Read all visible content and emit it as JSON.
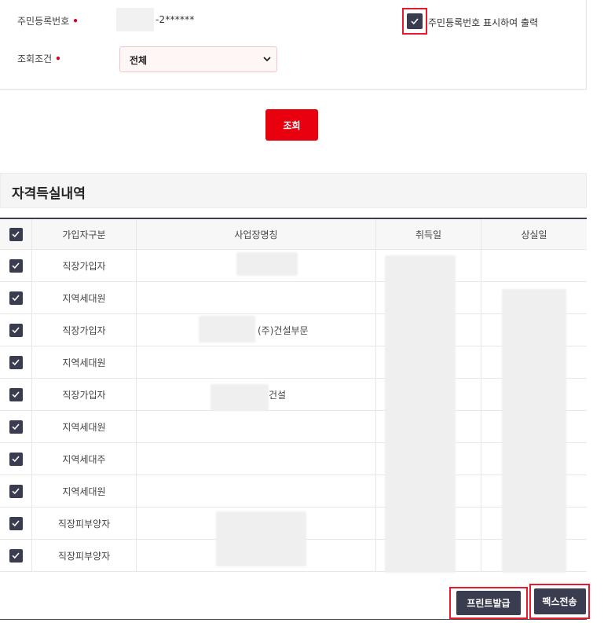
{
  "form": {
    "rrn_label": "주민등록번호",
    "rrn_required_mark": "•",
    "rrn_value_suffix": "-2******",
    "show_rrn_checkbox_label": "주민등록번호 표시하여 출력",
    "show_rrn_checked": true,
    "condition_label": "조회조건",
    "condition_required_mark": "•",
    "condition_selected": "전체"
  },
  "search_button_label": "조회",
  "section": {
    "title": "자격득실내역"
  },
  "table": {
    "headers": [
      "가입자구분",
      "사업장명칭",
      "취득일",
      "상실일"
    ],
    "rows": [
      {
        "type": "직장가입자",
        "workplace": "",
        "checked": true
      },
      {
        "type": "지역세대원",
        "workplace": "",
        "checked": true
      },
      {
        "type": "직장가입자",
        "workplace": "(주)건설부문",
        "checked": true
      },
      {
        "type": "지역세대원",
        "workplace": "",
        "checked": true
      },
      {
        "type": "직장가입자",
        "workplace": "건설",
        "checked": true
      },
      {
        "type": "지역세대원",
        "workplace": "",
        "checked": true
      },
      {
        "type": "지역세대주",
        "workplace": "",
        "checked": true
      },
      {
        "type": "지역세대원",
        "workplace": "",
        "checked": true
      },
      {
        "type": "직장피부양자",
        "workplace": "",
        "checked": true
      },
      {
        "type": "직장피부양자",
        "workplace": "",
        "checked": true
      }
    ]
  },
  "footer": {
    "print_button_label": "프린트발급",
    "fax_button_label": "팩스전송"
  },
  "colors": {
    "primary_red": "#e8000e",
    "highlight_red": "#e8192c",
    "dark_navy": "#3a3d4f"
  }
}
